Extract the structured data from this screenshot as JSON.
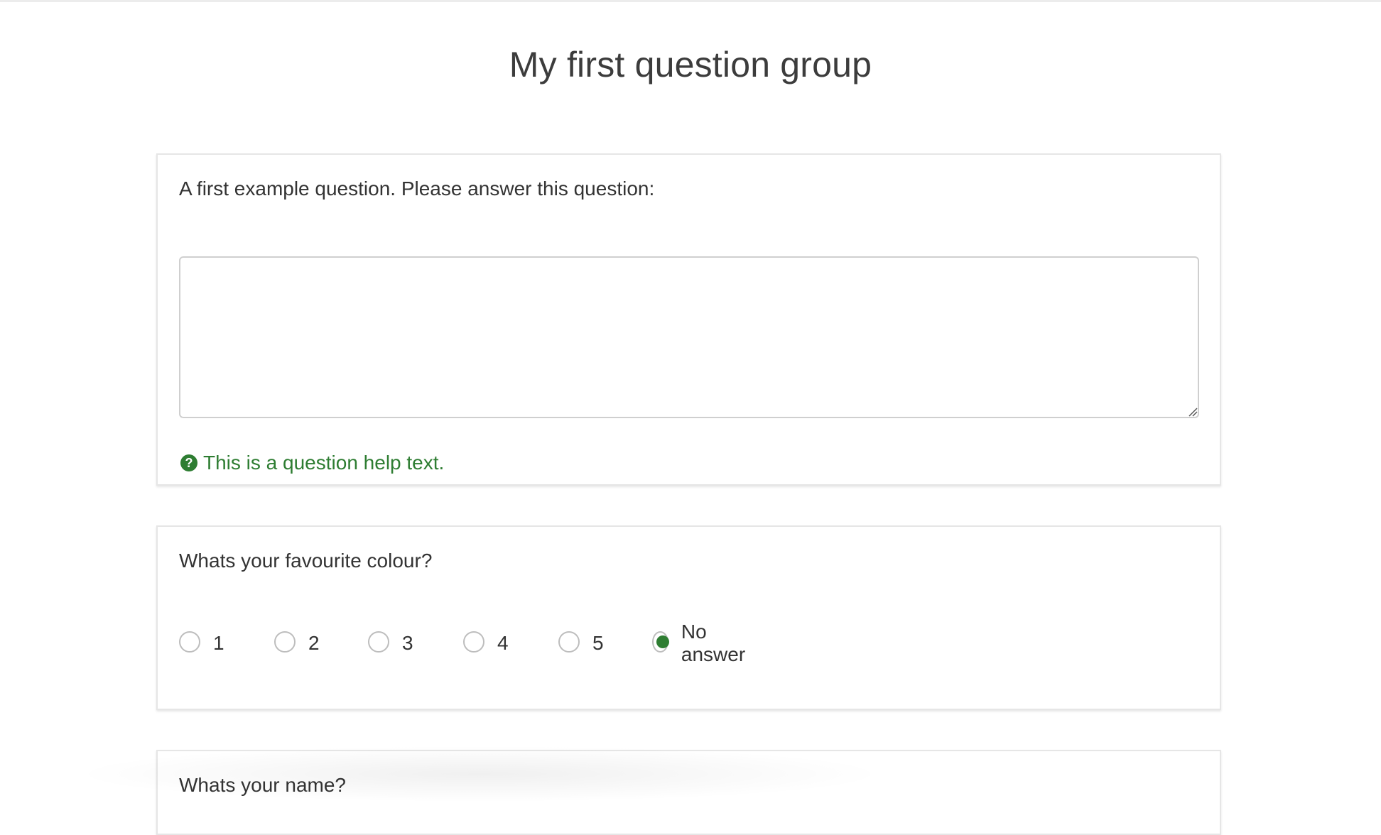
{
  "group": {
    "title": "My first question group"
  },
  "questions": [
    {
      "text": "A first example question. Please answer this question:",
      "answer_value": "",
      "help_text": "This is a question help text."
    },
    {
      "text": "Whats your favourite colour?",
      "options": [
        "1",
        "2",
        "3",
        "4",
        "5",
        "No answer"
      ],
      "selected": "No answer"
    },
    {
      "text": "Whats your name?"
    }
  ],
  "colors": {
    "accent": "#2e7d32",
    "text": "#333333",
    "border": "#e6e6e6"
  },
  "icons": {
    "help": "question-circle-icon"
  }
}
